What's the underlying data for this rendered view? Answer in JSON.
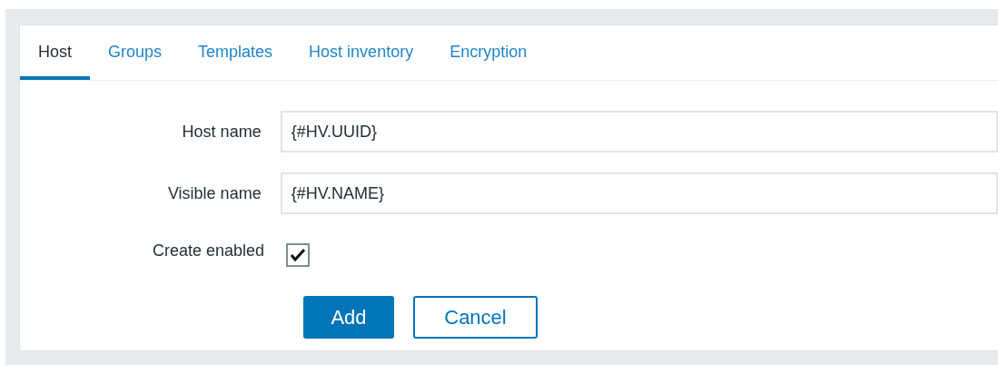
{
  "tabs": [
    {
      "label": "Host",
      "selected": true
    },
    {
      "label": "Groups",
      "selected": false
    },
    {
      "label": "Templates",
      "selected": false
    },
    {
      "label": "Host inventory",
      "selected": false
    },
    {
      "label": "Encryption",
      "selected": false
    }
  ],
  "fields": [
    {
      "kind": "text",
      "label": "Host name",
      "value": "{#HV.UUID}"
    },
    {
      "kind": "text",
      "label": "Visible name",
      "value": "{#HV.NAME}"
    },
    {
      "kind": "checkbox",
      "label": "Create enabled",
      "checked": true
    }
  ],
  "buttons": [
    {
      "label": "Add",
      "kind": "primary"
    },
    {
      "label": "Cancel",
      "kind": "secondary"
    }
  ]
}
